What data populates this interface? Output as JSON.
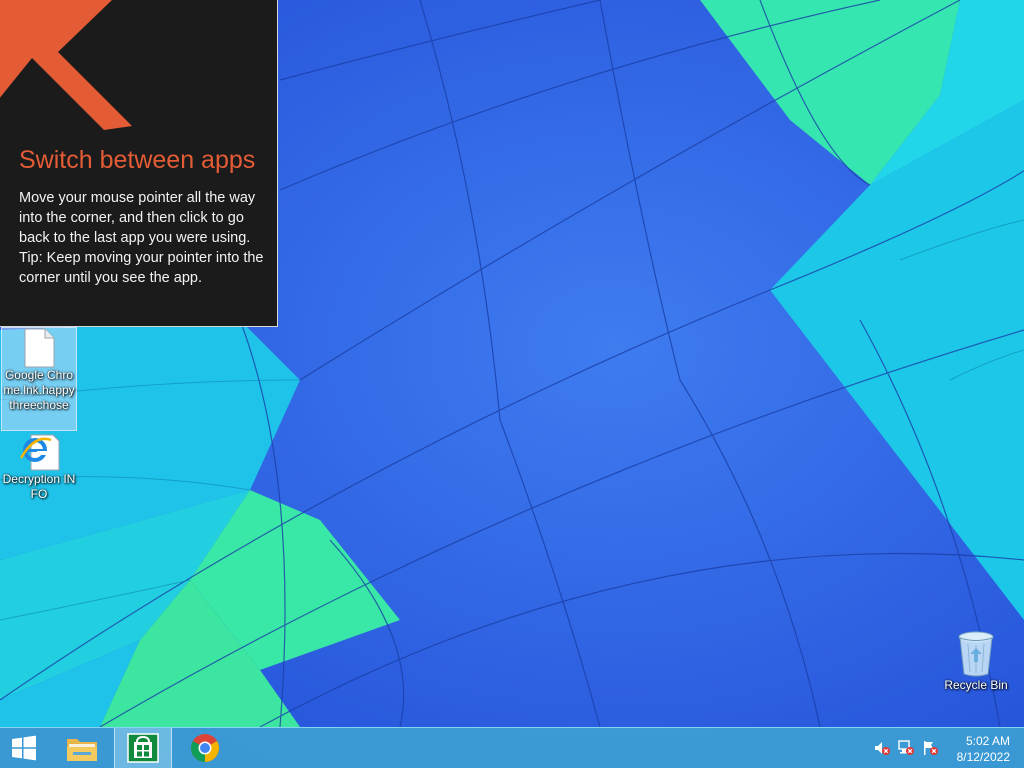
{
  "tip": {
    "title": "Switch between apps",
    "body_line1": "Move your mouse pointer all the way into the corner, and then click to go back to the last app you were using.",
    "body_line2": "Tip: Keep moving your pointer into the corner until you see the app.",
    "icon": "arrow-up-left-icon",
    "accent_color": "#e35c36"
  },
  "desktop": {
    "icons": [
      {
        "label": "Google Chrome.lnk.happythreechose",
        "icon": "document-icon",
        "selected": true
      },
      {
        "label": "Decryption INFO",
        "icon": "internet-explorer-icon",
        "selected": false
      },
      {
        "label": "Recycle Bin",
        "icon": "recycle-bin-icon",
        "selected": false
      }
    ]
  },
  "taskbar": {
    "items": [
      {
        "icon": "windows-start-icon"
      },
      {
        "icon": "file-explorer-icon"
      },
      {
        "icon": "windows-store-icon",
        "active": true
      },
      {
        "icon": "chrome-icon"
      }
    ],
    "tray": [
      {
        "icon": "volume-muted-icon"
      },
      {
        "icon": "network-error-icon"
      },
      {
        "icon": "action-center-flag-icon"
      }
    ],
    "clock": {
      "time": "5:02 AM",
      "date": "8/12/2022"
    },
    "background_color": "#40a8d2"
  }
}
